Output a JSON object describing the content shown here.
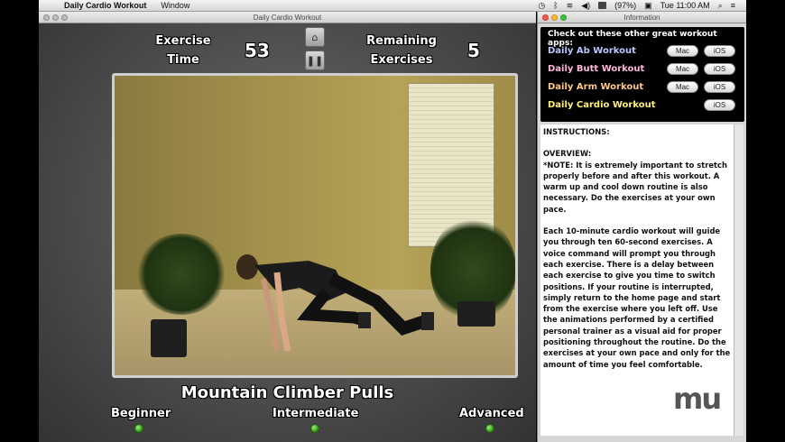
{
  "menubar": {
    "app_name": "Daily Cardio Workout",
    "menu_window": "Window",
    "battery": "(97%)",
    "clock": "Tue 11:00 AM"
  },
  "main_window": {
    "title": "Daily Cardio Workout",
    "exercise_time_label": "Exercise\nTime",
    "exercise_time_value": "53",
    "remaining_label": "Remaining\nExercises",
    "remaining_value": "5",
    "home_icon": "home-icon",
    "pause_icon": "pause-icon",
    "exercise_name": "Mountain Climber Pulls",
    "levels": [
      "Beginner",
      "Intermediate",
      "Advanced"
    ]
  },
  "info_window": {
    "title": "Information",
    "apps_header": "Check out these other great workout apps:",
    "apps": [
      {
        "name": "Daily Ab Workout",
        "color": "#b9c7ff",
        "mac": "Mac",
        "ios": "iOS"
      },
      {
        "name": "Daily Butt Workout",
        "color": "#ffb6d9",
        "mac": "Mac",
        "ios": "iOS"
      },
      {
        "name": "Daily Arm Workout",
        "color": "#ffc98a",
        "mac": "Mac",
        "ios": "iOS"
      },
      {
        "name": "Daily Cardio Workout",
        "color": "#fff07a",
        "ios": "iOS"
      }
    ],
    "instructions_title": "INSTRUCTIONS:",
    "overview_title": "OVERVIEW:",
    "note": "*NOTE: It is extremely important to stretch properly before and after this workout. A warm up and cool down routine is also necessary. Do the exercises at your own pace.",
    "body": "Each 10-minute cardio workout will guide you through ten 60-second exercises. A voice command will prompt you through each exercise. There is a delay between each exercise to give you time to switch positions. If your routine is interrupted, simply return to the home page and start from the exercise where you left off. Use the animations performed by a certified personal trainer as a visual aid for proper positioning throughout the routine. Do the exercises at your own pace and only for the amount of time you feel comfortable.",
    "logo_text": "mu"
  }
}
